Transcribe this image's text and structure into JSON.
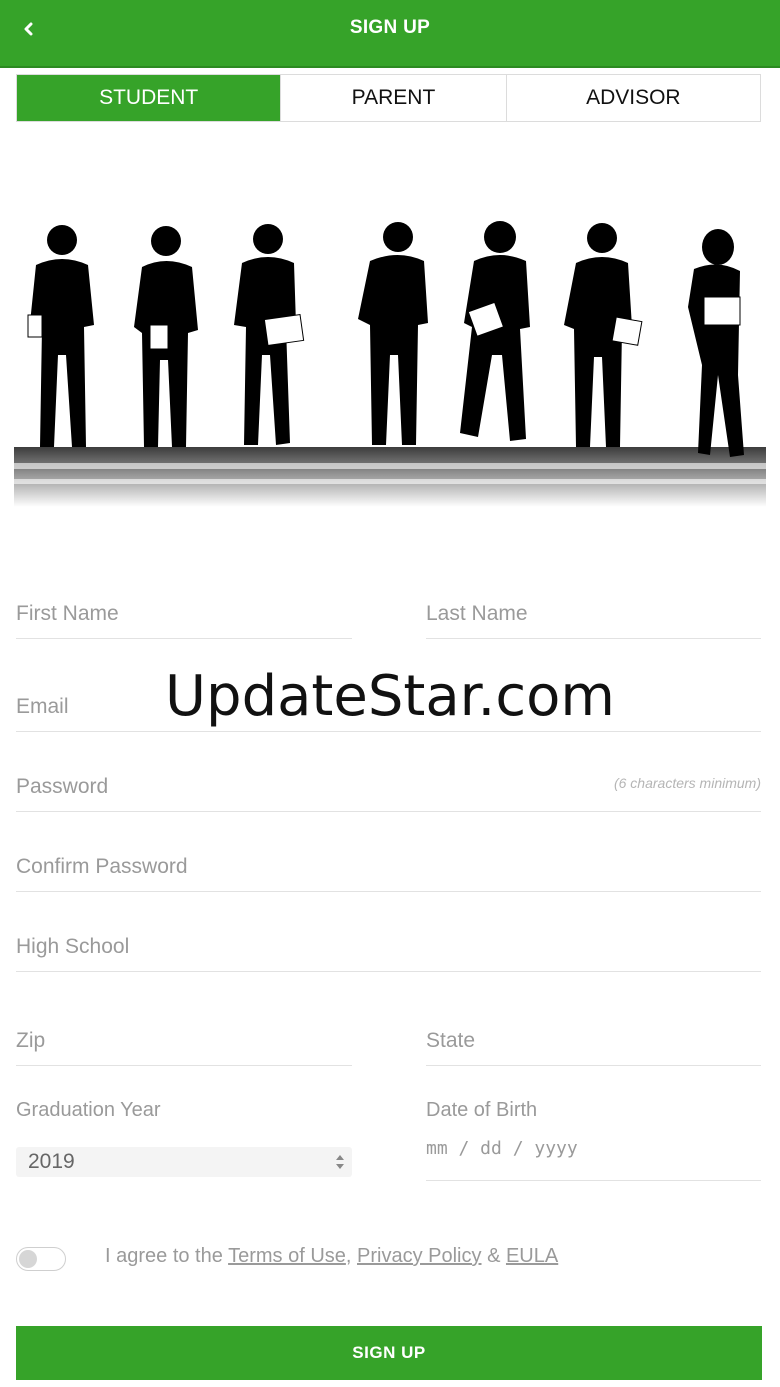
{
  "header": {
    "title": "SIGN UP",
    "back_icon": "chevron-left-icon"
  },
  "tabs": [
    {
      "label": "STUDENT",
      "active": true
    },
    {
      "label": "PARENT",
      "active": false
    },
    {
      "label": "ADVISOR",
      "active": false
    }
  ],
  "hero": {
    "image": "student-silhouettes-illustration"
  },
  "form": {
    "first_name": {
      "placeholder": "First Name",
      "value": ""
    },
    "last_name": {
      "placeholder": "Last Name",
      "value": ""
    },
    "email": {
      "placeholder": "Email",
      "value": ""
    },
    "password": {
      "placeholder": "Password",
      "hint": "(6 characters minimum)",
      "value": ""
    },
    "confirm_password": {
      "placeholder": "Confirm Password",
      "value": ""
    },
    "high_school": {
      "placeholder": "High School",
      "value": ""
    },
    "zip": {
      "placeholder": "Zip",
      "value": ""
    },
    "state": {
      "placeholder": "State",
      "value": ""
    },
    "graduation_year": {
      "label": "Graduation Year",
      "selected": "2019"
    },
    "date_of_birth": {
      "label": "Date of Birth",
      "placeholder": "mm / dd / yyyy"
    }
  },
  "agreement": {
    "prefix": "I agree to the",
    "terms": "Terms of Use",
    "comma": ",",
    "privacy": "Privacy Policy",
    "amp": "&",
    "eula": "EULA",
    "checked": false
  },
  "submit": {
    "label": "SIGN UP"
  },
  "watermark": "UpdateStar.com",
  "colors": {
    "primary": "#36a329",
    "placeholder": "#9a9a9a",
    "divider": "#e2e2e2"
  }
}
